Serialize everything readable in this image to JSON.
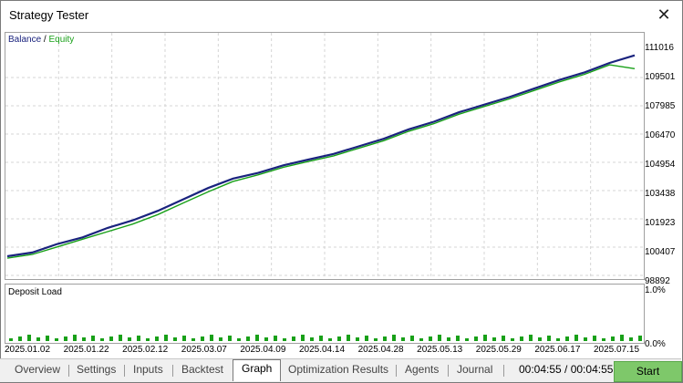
{
  "window": {
    "title": "Strategy Tester",
    "close_glyph": "✕"
  },
  "legend": {
    "balance": "Balance",
    "separator": " / ",
    "equity": "Equity"
  },
  "deposit": {
    "title": "Deposit Load",
    "ticks": [
      "1.0%",
      "0.0%"
    ]
  },
  "y_ticks": [
    "111016",
    "109501",
    "107985",
    "106470",
    "104954",
    "103438",
    "101923",
    "100407",
    "98892"
  ],
  "x_ticks": [
    "2025.01.02",
    "2025.01.22",
    "2025.02.12",
    "2025.03.07",
    "2025.04.09",
    "2025.04.14",
    "2025.04.28",
    "2025.05.13",
    "2025.05.29",
    "2025.06.17",
    "2025.07.15"
  ],
  "tabs": [
    "Overview",
    "Settings",
    "Inputs",
    "Backtest",
    "Graph",
    "Optimization Results",
    "Agents",
    "Journal"
  ],
  "active_tab": "Graph",
  "timer": "00:04:55 / 00:04:55",
  "start_label": "Start",
  "colors": {
    "balance": "#1a237e",
    "equity": "#18a018",
    "deposit": "#18a018",
    "start": "#7ec86a"
  },
  "chart_data": {
    "type": "line",
    "ylim": [
      98892,
      111016
    ],
    "series": [
      {
        "name": "Balance",
        "values": [
          99900,
          100100,
          100550,
          100900,
          101400,
          101800,
          102300,
          102900,
          103500,
          104000,
          104300,
          104700,
          105000,
          105300,
          105700,
          106100,
          106600,
          107000,
          107500,
          107900,
          108300,
          108750,
          109200,
          109600,
          110100,
          110500
        ]
      },
      {
        "name": "Equity",
        "values": [
          99800,
          100000,
          100400,
          100800,
          101200,
          101600,
          102100,
          102700,
          103300,
          103850,
          104200,
          104600,
          104900,
          105200,
          105600,
          106000,
          106500,
          106900,
          107400,
          107800,
          108200,
          108650,
          109100,
          109500,
          110000,
          109800
        ]
      }
    ]
  }
}
